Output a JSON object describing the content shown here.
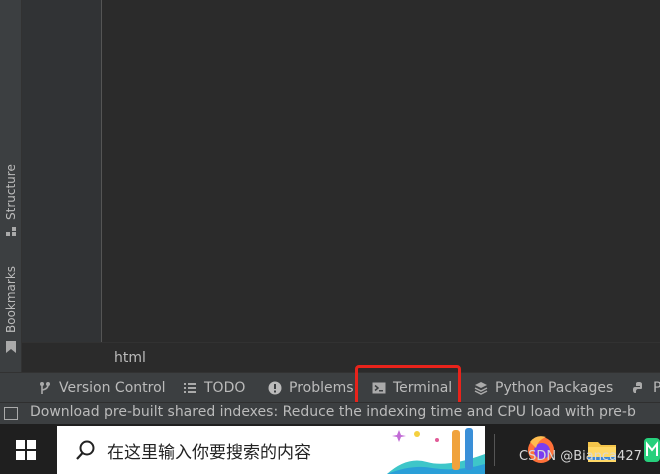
{
  "left_strip": {
    "structure_label": "Structure",
    "bookmarks_label": "Bookmarks"
  },
  "breadcrumb": "html",
  "tool_windows": [
    {
      "label": "Version Control",
      "icon": "branch-icon"
    },
    {
      "label": "TODO",
      "icon": "list-icon"
    },
    {
      "label": "Problems",
      "icon": "warning-icon"
    },
    {
      "label": "Terminal",
      "icon": "terminal-icon"
    },
    {
      "label": "Python Packages",
      "icon": "layers-icon"
    },
    {
      "label": "P",
      "icon": "python-icon"
    }
  ],
  "status": {
    "message": "Download pre-built shared indexes: Reduce the indexing time and CPU load with pre-b"
  },
  "taskbar": {
    "search_placeholder": "在这里输入你要搜索的内容",
    "watermark": "CSDN @Bianca427"
  },
  "colors": {
    "highlight": "#e8231b",
    "ide_panel": "#3c3f41",
    "editor_bg": "#2b2b2b"
  }
}
